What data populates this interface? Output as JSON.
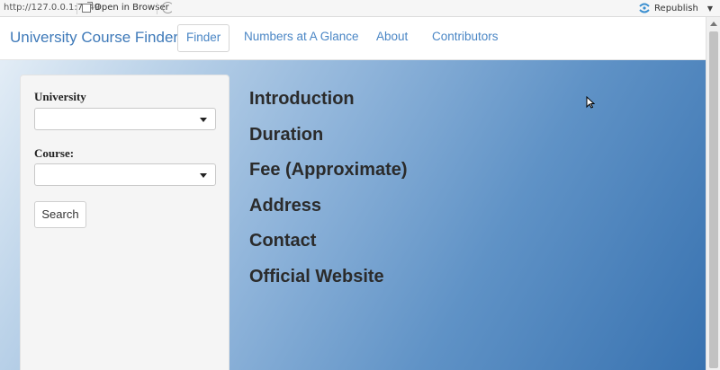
{
  "viewer": {
    "url": "http://127.0.0.1:7449",
    "open_in_browser": "Open in Browser",
    "republish": "Republish"
  },
  "navbar": {
    "brand": "University Course Finder",
    "items": [
      {
        "label": "Finder",
        "active": true
      },
      {
        "label": "Numbers at A Glance",
        "active": false
      },
      {
        "label": "About",
        "active": false
      },
      {
        "label": "Contributors",
        "active": false
      }
    ]
  },
  "sidebar": {
    "university_label": "University",
    "university_value": "",
    "course_label": "Course:",
    "course_value": "",
    "search_button": "Search"
  },
  "main": {
    "headings": [
      "Introduction",
      "Duration",
      "Fee (Approximate)",
      "Address",
      "Contact",
      "Official Website"
    ]
  },
  "colors": {
    "brand": "#3f7ab9",
    "nav_link": "#4a86c5",
    "gradient_start": "#e3edf6",
    "gradient_end": "#3872b0"
  },
  "icons": [
    "open-in-browser-icon",
    "refresh-icon",
    "republish-icon",
    "dropdown-caret-icon",
    "mouse-cursor-icon"
  ]
}
